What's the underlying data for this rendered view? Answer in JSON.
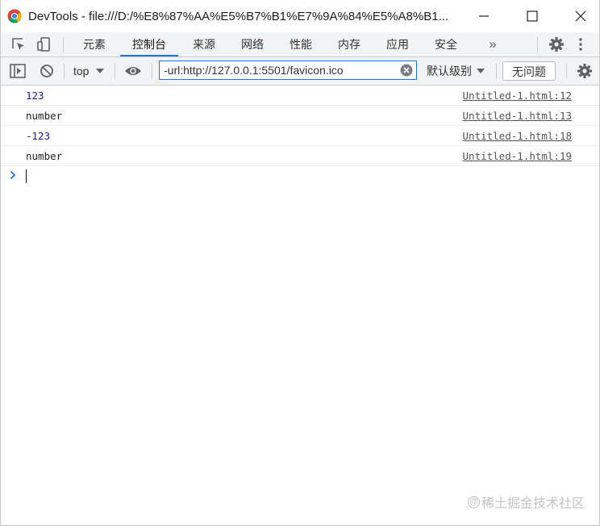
{
  "window": {
    "title": "DevTools - file:///D:/%E8%87%AA%E5%B7%B1%E7%9A%84%E5%A8%B1...",
    "app_icon": "chrome-icon",
    "controls": [
      "minimize-icon",
      "maximize-icon",
      "close-icon"
    ]
  },
  "tabs": {
    "items": [
      {
        "label": "元素"
      },
      {
        "label": "控制台",
        "active": true
      },
      {
        "label": "来源"
      },
      {
        "label": "网络"
      },
      {
        "label": "性能"
      },
      {
        "label": "内存"
      },
      {
        "label": "应用"
      },
      {
        "label": "安全"
      }
    ],
    "more": "»",
    "icons": [
      "inspect-element-icon",
      "device-toggle-icon",
      "gear-icon",
      "kebab-menu-icon"
    ]
  },
  "toolbar": {
    "context": "top",
    "filter_value": "-url:http://127.0.0.1:5501/favicon.ico",
    "levels": "默认级别",
    "issues": "无问题",
    "icons": [
      "sidebar-toggle-icon",
      "clear-console-icon",
      "eye-icon",
      "clear-filter-icon",
      "gear-icon"
    ]
  },
  "console": {
    "messages": [
      {
        "text": "123",
        "kind": "number",
        "source": "Untitled-1.html:12"
      },
      {
        "text": "number",
        "kind": "string",
        "source": "Untitled-1.html:13"
      },
      {
        "text": "-123",
        "kind": "number",
        "source": "Untitled-1.html:18"
      },
      {
        "text": "number",
        "kind": "string",
        "source": "Untitled-1.html:19"
      }
    ],
    "prompt": ">"
  },
  "watermark": {
    "text": "稀土掘金技术社区"
  },
  "colors": {
    "accent": "#1a73e8",
    "number_value": "#1a1aa6",
    "toolbar_bg": "#f1f3f4"
  }
}
